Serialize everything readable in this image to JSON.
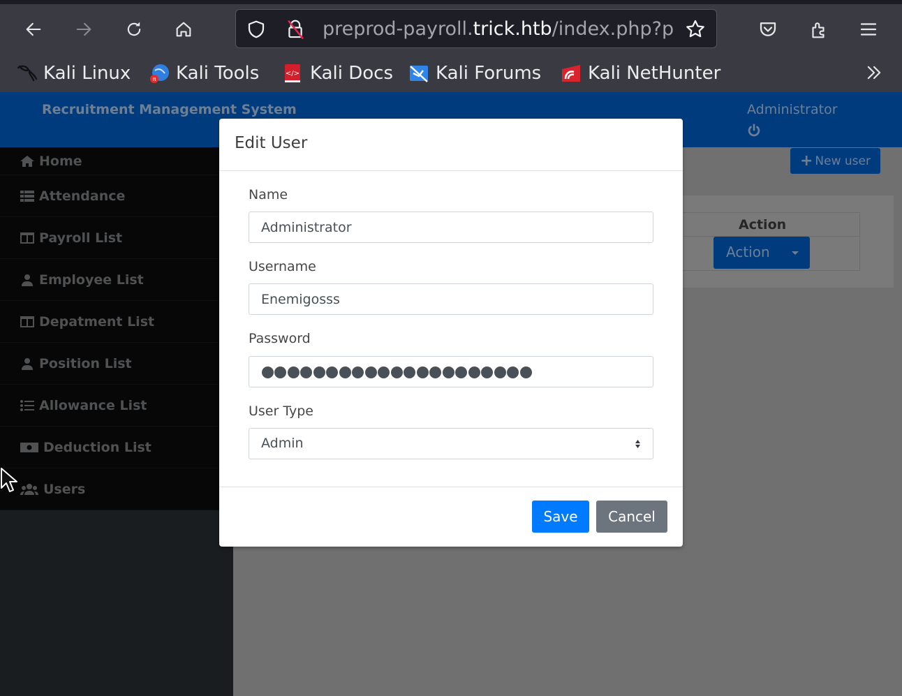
{
  "browser": {
    "url_prefix": "preprod-payroll.",
    "url_domain": "trick.htb",
    "url_suffix": "/index.php?p",
    "bookmarks": [
      {
        "label": "Kali Linux",
        "icon": "kali-dragon-icon"
      },
      {
        "label": "Kali Tools",
        "icon": "kali-tools-icon"
      },
      {
        "label": "Kali Docs",
        "icon": "kali-docs-icon"
      },
      {
        "label": "Kali Forums",
        "icon": "kali-forums-icon"
      },
      {
        "label": "Kali NetHunter",
        "icon": "kali-nethunter-icon"
      }
    ],
    "more_label": "»"
  },
  "app": {
    "title": "Recruitment Management System",
    "user_name": "Administrator",
    "colors": {
      "header": "#003c7d",
      "primary": "#007bff",
      "secondary": "#6c757d"
    }
  },
  "sidebar": {
    "items": [
      {
        "label": "Home",
        "icon": "home-icon"
      },
      {
        "label": "Attendance",
        "icon": "list-icon"
      },
      {
        "label": "Payroll List",
        "icon": "columns-icon"
      },
      {
        "label": "Employee List",
        "icon": "user-tie-icon"
      },
      {
        "label": "Depatment List",
        "icon": "columns-icon"
      },
      {
        "label": "Position List",
        "icon": "user-tie-icon"
      },
      {
        "label": "Allowance List",
        "icon": "list-ul-icon"
      },
      {
        "label": "Deduction List",
        "icon": "money-bill-icon"
      },
      {
        "label": "Users",
        "icon": "users-icon"
      }
    ]
  },
  "main": {
    "new_user_label": "New user",
    "table": {
      "columns": [
        "Action"
      ],
      "rows": [
        {
          "action_label": "Action"
        }
      ]
    }
  },
  "modal": {
    "title": "Edit User",
    "fields": {
      "name": {
        "label": "Name",
        "value": "Administrator"
      },
      "username": {
        "label": "Username",
        "value": "Enemigosss"
      },
      "password": {
        "label": "Password",
        "masked_length": 21
      },
      "user_type": {
        "label": "User Type",
        "selected": "Admin"
      }
    },
    "save_label": "Save",
    "cancel_label": "Cancel"
  }
}
